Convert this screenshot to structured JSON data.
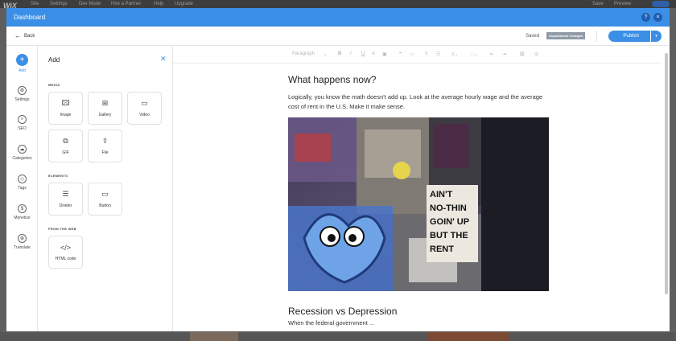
{
  "background": {
    "logo": "WiX",
    "menu": [
      "Site",
      "Settings",
      "Dev Mode",
      "Hire a Partner",
      "Help",
      "Upgrade"
    ],
    "save": "Save",
    "preview": "Preview"
  },
  "modal": {
    "title": "Dashboard",
    "help_icon": "?",
    "close_icon": "×"
  },
  "toolbar": {
    "back_label": "Back",
    "saved_label": "Saved",
    "unpublished_label": "Unpublished Changes",
    "publish_label": "Publish"
  },
  "leftnav": {
    "items": [
      {
        "label": "Add",
        "icon": "plus-icon",
        "glyph": "+"
      },
      {
        "label": "Settings",
        "icon": "gear-icon",
        "glyph": "⚙"
      },
      {
        "label": "SEO",
        "icon": "search-icon",
        "glyph": "⌕"
      },
      {
        "label": "Categories",
        "icon": "folder-icon",
        "glyph": "☁"
      },
      {
        "label": "Tags",
        "icon": "tag-icon",
        "glyph": "◇"
      },
      {
        "label": "Monetize",
        "icon": "dollar-icon",
        "glyph": "$"
      },
      {
        "label": "Translate",
        "icon": "globe-icon",
        "glyph": "⊕"
      }
    ]
  },
  "panel": {
    "title": "Add",
    "sections": {
      "media": "MEDIA",
      "elements": "ELEMENTS",
      "web": "FROM THE WEB"
    },
    "tiles": {
      "image": "Image",
      "gallery": "Gallery",
      "video": "Video",
      "gif": "GIF",
      "file": "File",
      "divider": "Divider",
      "button": "Button",
      "html": "HTML code"
    }
  },
  "format_toolbar": {
    "paragraph_style": "Paragraph"
  },
  "post": {
    "heading1": "What happens now?",
    "paragraph1": "Logically, you know the math doesn't add up. Look at the average hourly wage and the average cost of rent in the U.S. Make it make sense.",
    "image_text": [
      "AIN'T",
      "NO-THIN",
      "GOIN' UP",
      "BUT THE",
      "RENT"
    ],
    "heading2": "Recession vs Depression",
    "paragraph2": "When the federal government ..."
  }
}
